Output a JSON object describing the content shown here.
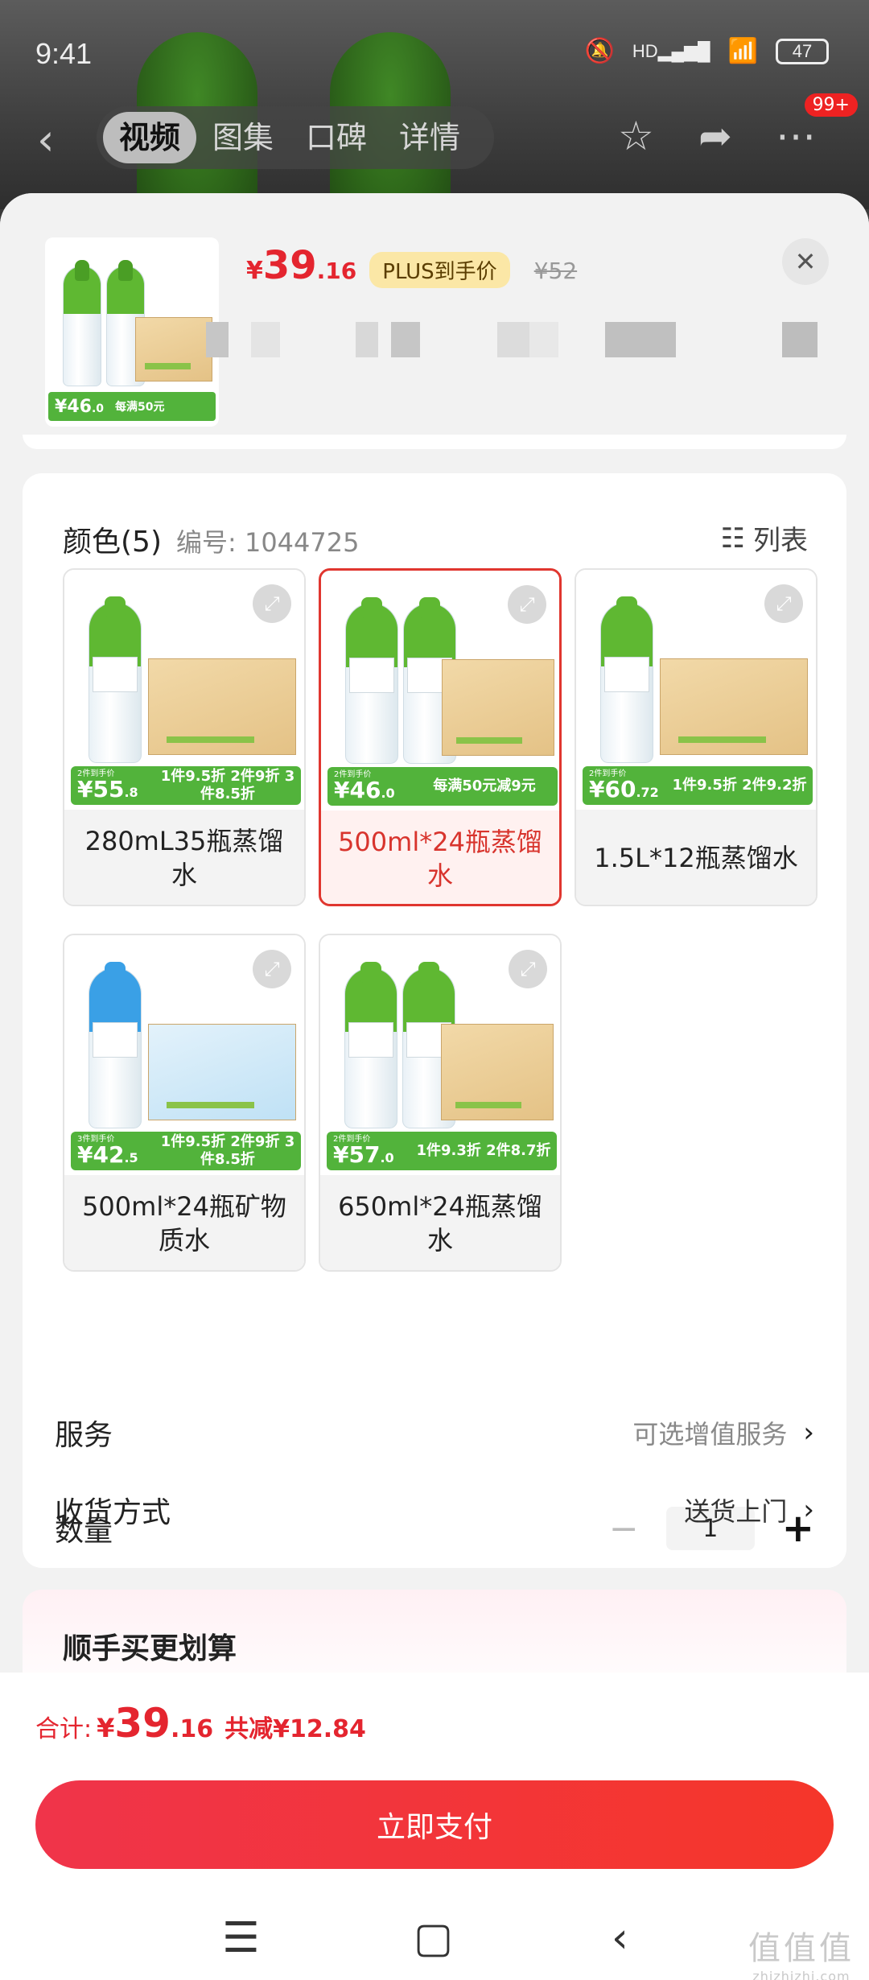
{
  "status_bar": {
    "time": "9:41",
    "signal_label": "HD",
    "battery": "47"
  },
  "top_nav": {
    "tabs": [
      "视频",
      "图集",
      "口碑",
      "详情"
    ],
    "badge": "99+"
  },
  "product": {
    "currency": "¥",
    "price_int": "39",
    "price_dec": ".16",
    "plus_tag": "PLUS到手价",
    "original_price": "¥52",
    "thumb_promo_price": "46",
    "thumb_promo_dec": ".0",
    "thumb_promo_text": "每满50元"
  },
  "color_section": {
    "title": "颜色(5)",
    "sku": "编号: 1044725",
    "list_label": "列表",
    "options": [
      {
        "label": "280mL35瓶蒸馏水",
        "promo_caption": "2件到手价",
        "promo_price": "55",
        "promo_dec": ".8",
        "promo_text": "1件9.5折 2件9折 3件8.5折",
        "selected": false,
        "cap_color": "#5fb832"
      },
      {
        "label": "500ml*24瓶蒸馏水",
        "promo_caption": "2件到手价",
        "promo_price": "46",
        "promo_dec": ".0",
        "promo_text": "每满50元减9元",
        "selected": true,
        "cap_color": "#5fb832"
      },
      {
        "label": "1.5L*12瓶蒸馏水",
        "promo_caption": "2件到手价",
        "promo_price": "60",
        "promo_dec": ".72",
        "promo_text": "1件9.5折 2件9.2折",
        "selected": false,
        "cap_color": "#5fb832"
      },
      {
        "label": "500ml*24瓶矿物质水",
        "promo_caption": "3件到手价",
        "promo_price": "42",
        "promo_dec": ".5",
        "promo_text": "1件9.5折 2件9折 3件8.5折",
        "selected": false,
        "cap_color": "#3aa0e6"
      },
      {
        "label": "650ml*24瓶蒸馏水",
        "promo_caption": "2件到手价",
        "promo_price": "57",
        "promo_dec": ".0",
        "promo_text": "1件9.3折 2件8.7折",
        "selected": false,
        "cap_color": "#5fb832"
      }
    ]
  },
  "quantity": {
    "label": "数量",
    "value": "1"
  },
  "service": {
    "label": "服务",
    "value": "可选增值服务"
  },
  "delivery": {
    "label": "收货方式",
    "value": "送货上门"
  },
  "upsell": {
    "title": "顺手买更划算"
  },
  "footer": {
    "total_label": "合计:",
    "currency": "¥",
    "total_int": "39",
    "total_dec": ".16",
    "discount": "共减¥12.84",
    "pay_button": "立即支付"
  },
  "watermark": {
    "text": "值值值",
    "sub": "zhizhizhi.com"
  },
  "colors": {
    "accent_red": "#e4252f",
    "brand_green": "#52b33b"
  }
}
